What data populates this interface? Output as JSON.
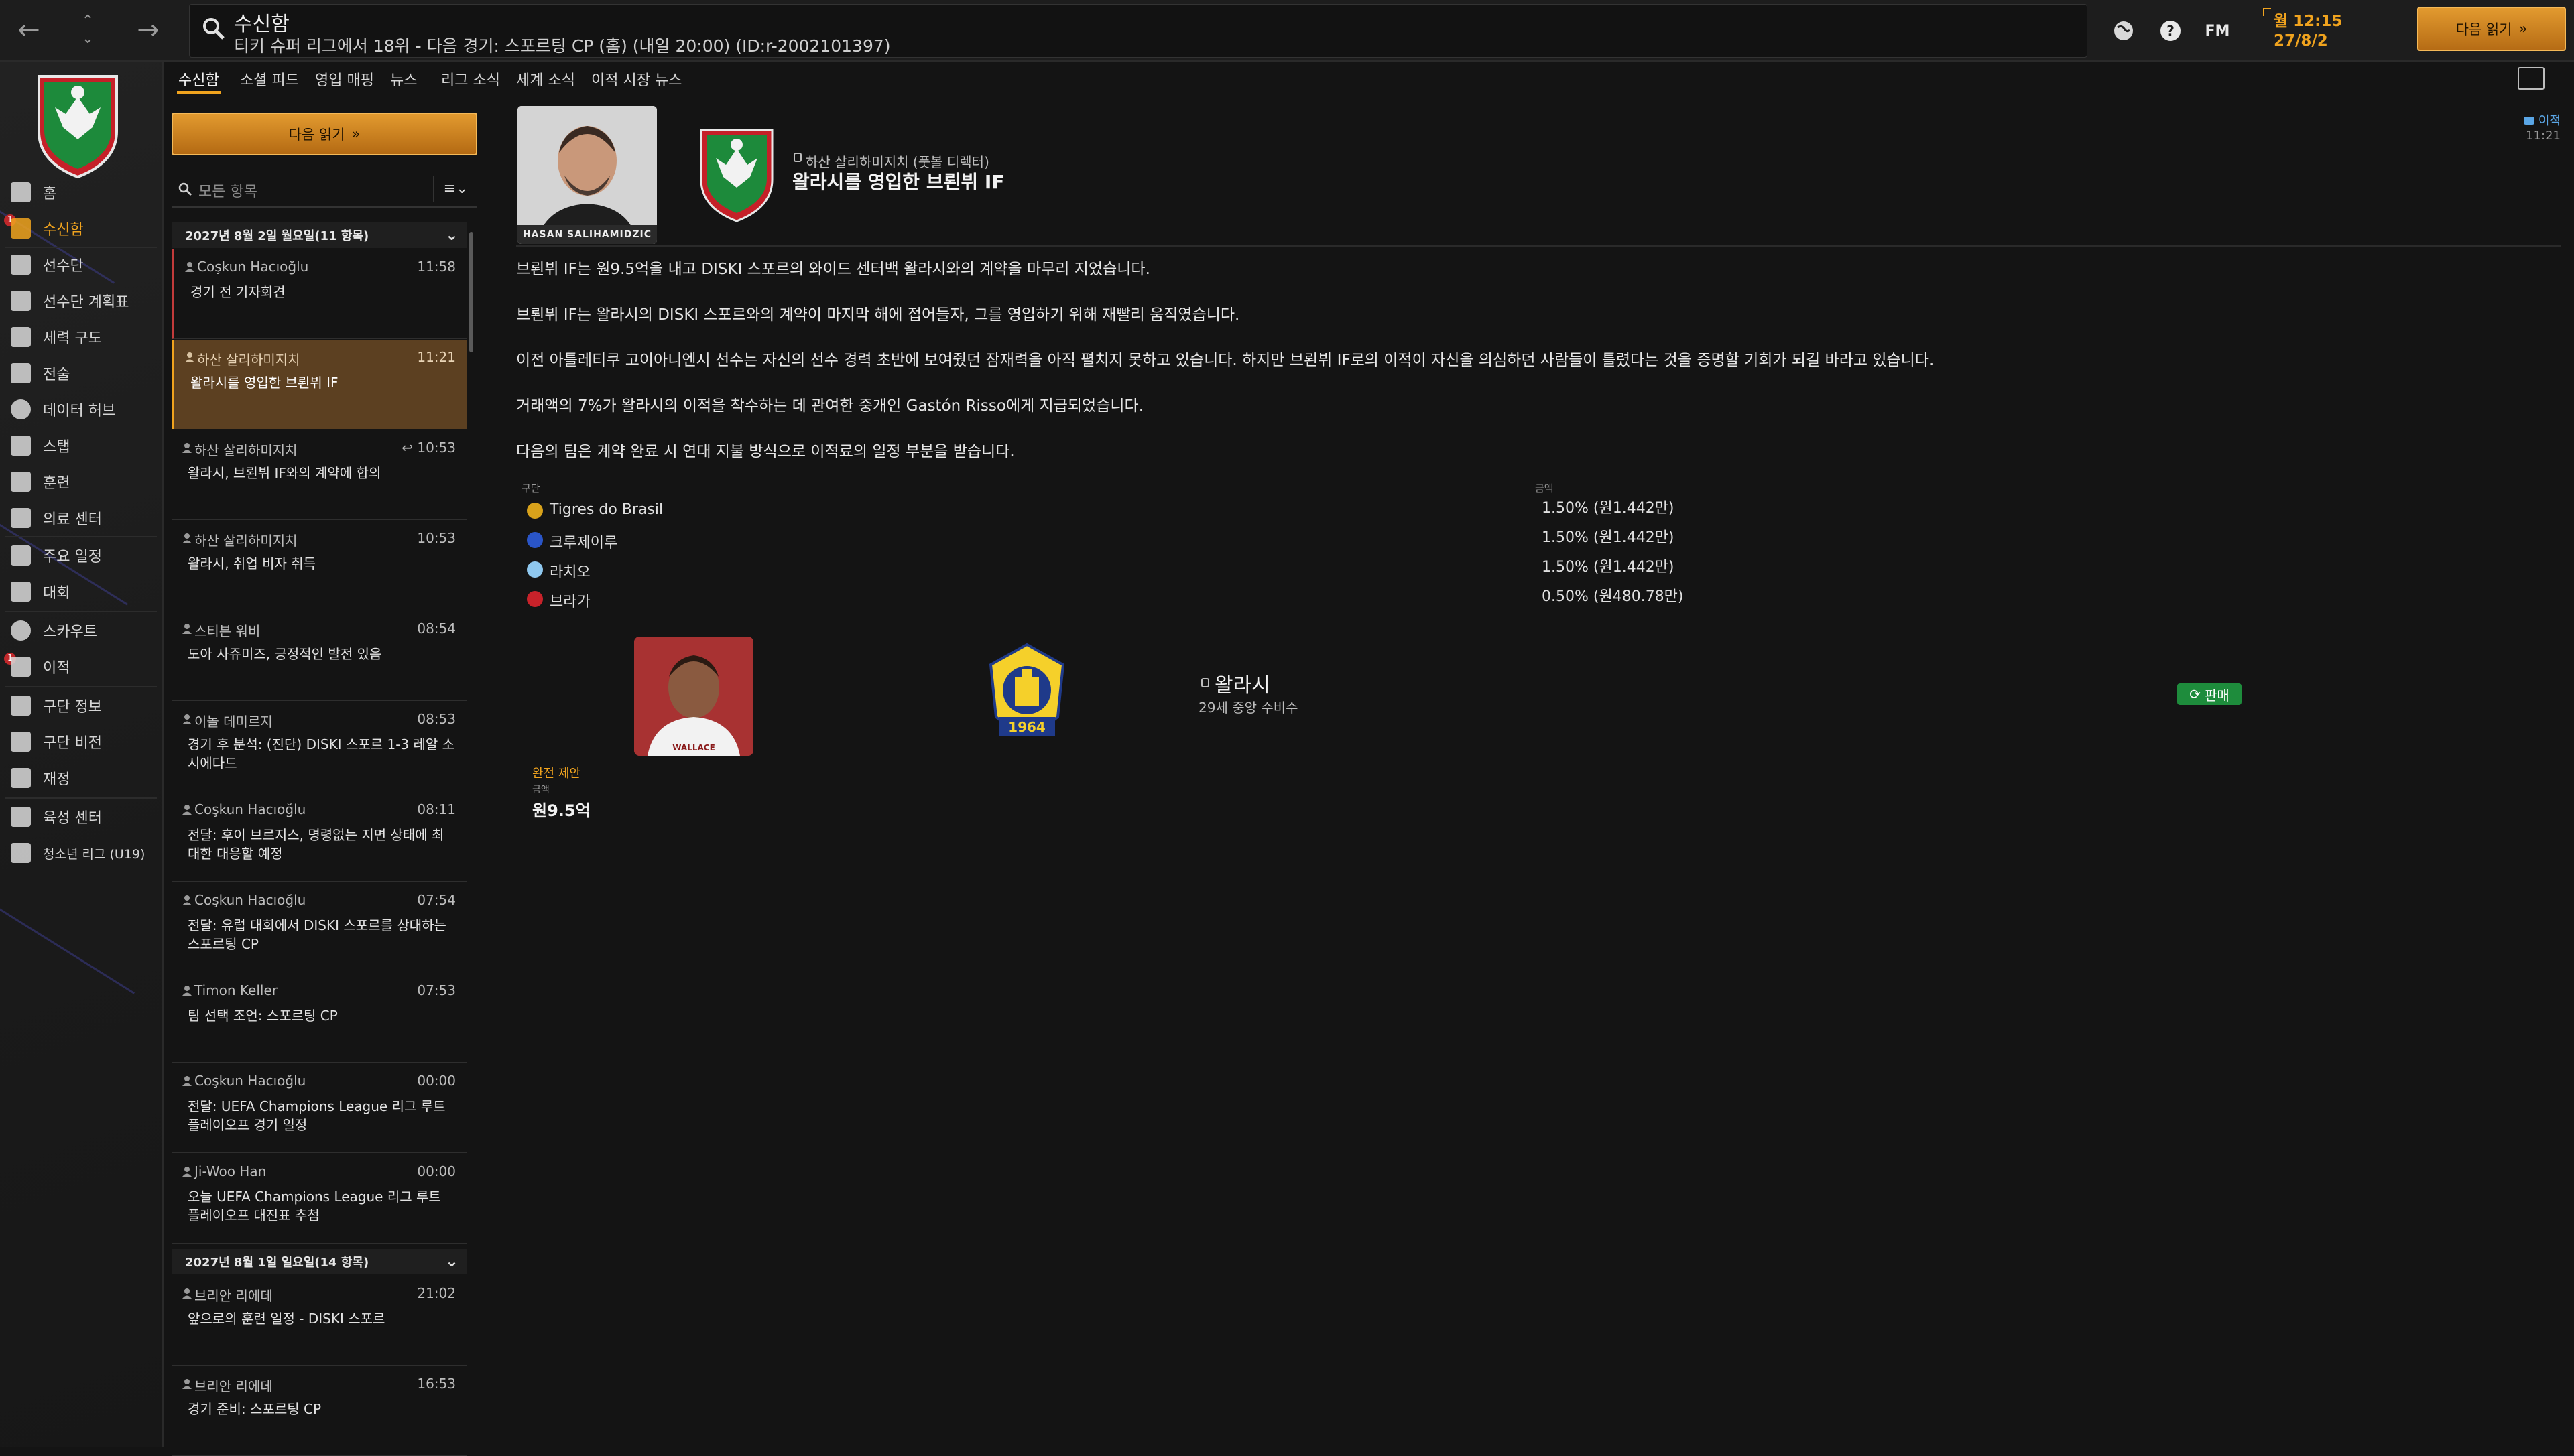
{
  "topbar": {
    "title": "수신함",
    "subtitle": "티키 슈퍼 리그에서 18위 - 다음 경기: 스포르팅 CP (홈) (내일 20:00) (ID:r-2002101397)",
    "fm_label": "FM",
    "date_time": "월 12:15",
    "date_date": "27/8/2",
    "continue_label": "다음 읽기"
  },
  "sidebar": {
    "items": [
      {
        "label": "홈"
      },
      {
        "label": "수신함",
        "badge": "1"
      },
      {
        "label": "선수단"
      },
      {
        "label": "선수단 계획표"
      },
      {
        "label": "세력 구도"
      },
      {
        "label": "전술"
      },
      {
        "label": "데이터 허브"
      },
      {
        "label": "스탭"
      },
      {
        "label": "훈련"
      },
      {
        "label": "의료 센터"
      },
      {
        "label": "주요 일정"
      },
      {
        "label": "대회"
      },
      {
        "label": "스카우트"
      },
      {
        "label": "이적",
        "badge": "1"
      },
      {
        "label": "구단 정보"
      },
      {
        "label": "구단 비전"
      },
      {
        "label": "재정"
      },
      {
        "label": "육성 센터"
      },
      {
        "label": "청소년 리그 (U19)"
      }
    ]
  },
  "subtabs": [
    "수신함",
    "소셜 피드",
    "영입 매핑",
    "뉴스",
    "리그 소식",
    "세계 소식",
    "이적 시장 뉴스"
  ],
  "inbox": {
    "continue_label": "다음 읽기",
    "filter_placeholder": "모든 항목",
    "sort_label": "≡⌄",
    "group1": "2027년 8월 2일 월요일(11 항목)",
    "group2": "2027년 8월 1일 일요일(14 항목)",
    "messages": [
      {
        "sender": "Coşkun Hacıoğlu",
        "time": "11:58",
        "subject": "경기 전 기자회견"
      },
      {
        "sender": "하산 살리하미지치",
        "time": "11:21",
        "subject": "왈라시를 영입한 브뢴뷔 IF"
      },
      {
        "sender": "하산 살리하미지치",
        "time": "10:53",
        "subject": "왈라시, 브뢴뷔 IF와의 계약에 합의"
      },
      {
        "sender": "하산 살리하미지치",
        "time": "10:53",
        "subject": "왈라시, 취업 비자 취득"
      },
      {
        "sender": "스티븐 워비",
        "time": "08:54",
        "subject": "도아 사쥬미즈, 긍정적인 발전 있음"
      },
      {
        "sender": "이놀 데미르지",
        "time": "08:53",
        "subject": "경기 후 분석: (진단) DISKI 스포르 1-3 레알 소시에다드"
      },
      {
        "sender": "Coşkun Hacıoğlu",
        "time": "08:11",
        "subject": "전달: 후이 브르지스, 명령없는 지면 상태에 최대한 대응할 예정"
      },
      {
        "sender": "Coşkun Hacıoğlu",
        "time": "07:54",
        "subject": "전달: 유럽 대회에서 DISKI 스포르를 상대하는 스포르팅 CP"
      },
      {
        "sender": "Timon Keller",
        "time": "07:53",
        "subject": "팀 선택 조언: 스포르팅 CP"
      },
      {
        "sender": "Coşkun Hacıoğlu",
        "time": "00:00",
        "subject": "전달: UEFA Champions League 리그 루트 플레이오프 경기 일정"
      },
      {
        "sender": "Ji-Woo Han",
        "time": "00:00",
        "subject": "오늘 UEFA Champions League 리그 루트 플레이오프 대진표 추첨"
      },
      {
        "sender": "브리안 리에데",
        "time": "21:02",
        "subject": "앞으로의 훈련 일정 - DISKI 스포르"
      },
      {
        "sender": "브리안 리에데",
        "time": "16:53",
        "subject": "경기 준비: 스포르팅 CP"
      }
    ]
  },
  "article": {
    "photo_caption": "HASAN SALIHAMIDZIC",
    "author": "하산 살리하미지치 (풋볼 디렉터)",
    "title": "왈라시를 영입한 브뢴뷔 IF",
    "tag": "이적",
    "tag_time": "11:21",
    "paragraphs": [
      "브뢴뷔 IF는 원9.5억을 내고 DISKI 스포르의 와이드 센터백 왈라시와의 계약을 마무리 지었습니다.",
      "브뢴뷔 IF는 왈라시의 DISKI 스포르와의 계약이 마지막 해에 접어들자, 그를 영입하기 위해 재빨리 움직였습니다.",
      "이전 아틀레티쿠 고이아니엔시 선수는 자신의 선수 경력 초반에 보여줬던 잠재력을 아직 펼치지 못하고 있습니다. 하지만 브뢴뷔 IF로의 이적이 자신을 의심하던 사람들이 틀렸다는 것을 증명할 기회가 되길 바라고 있습니다.",
      "거래액의 7%가 왈라시의 이적을 착수하는 데 관여한 중개인 Gastón Risso에게 지급되었습니다.",
      "다음의 팀은 계약 완료 시 연대 지불 방식으로 이적료의 일정 부분을 받습니다."
    ],
    "fee_header_club": "구단",
    "fee_header_amount": "금액",
    "fees": [
      {
        "club": "Tigres do Brasil",
        "amount": "1.50% (원1.442만)",
        "color": "#d8a21b"
      },
      {
        "club": "크루제이루",
        "amount": "1.50% (원1.442만)",
        "color": "#2a55c8"
      },
      {
        "club": "라치오",
        "amount": "1.50% (원1.442만)",
        "color": "#8fc8ef"
      },
      {
        "club": "브라가",
        "amount": "0.50% (원480.78만)",
        "color": "#c8222a"
      }
    ],
    "player_name": "왈라시",
    "player_desc": "29세 중앙 수비수",
    "player_photo_caption": "WALLACE",
    "club_crest_year": "1964",
    "sale_label": "판매",
    "deal_type": "완전 제안",
    "deal_amount_label": "금액",
    "deal_amount": "원9.5억"
  },
  "colors": {
    "accent": "#f0a31e",
    "background": "#141414",
    "selected_row": "#5c4021",
    "sale_green": "#1e8c3c",
    "link_blue": "#5aa6e6"
  }
}
